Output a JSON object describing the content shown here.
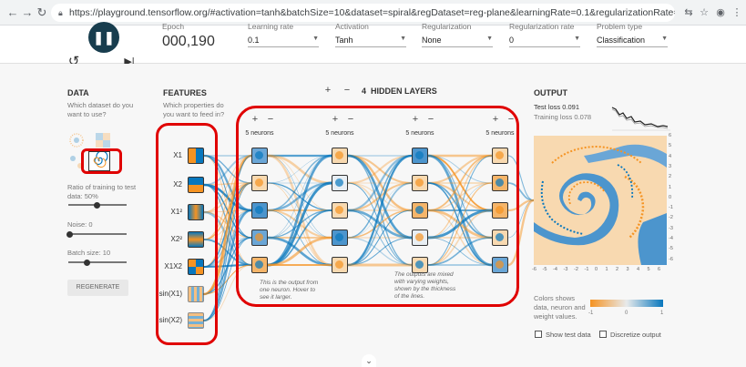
{
  "browser": {
    "url": "https://playground.tensorflow.org/#activation=tanh&batchSize=10&dataset=spiral&regDataset=reg-plane&learningRate=0.1&regularizationRate=0&noise=0&networkShape=5,5,5,5&s..."
  },
  "controls": {
    "epoch_label": "Epoch",
    "epoch_value": "000,190",
    "learning_rate_label": "Learning rate",
    "learning_rate_value": "0.1",
    "activation_label": "Activation",
    "activation_value": "Tanh",
    "regularization_label": "Regularization",
    "regularization_value": "None",
    "regularization_rate_label": "Regularization rate",
    "regularization_rate_value": "0",
    "problem_type_label": "Problem type",
    "problem_type_value": "Classification"
  },
  "data_panel": {
    "title": "DATA",
    "subtitle": "Which dataset do you want to use?",
    "ratio_label": "Ratio of training to test data:  50%",
    "noise_label": "Noise:  0",
    "batch_label": "Batch size:  10",
    "regenerate_label": "REGENERATE"
  },
  "features_panel": {
    "title": "FEATURES",
    "subtitle": "Which properties do you want to feed in?",
    "features": [
      "X1",
      "X2",
      "X1²",
      "X2²",
      "X1X2",
      "sin(X1)",
      "sin(X2)"
    ]
  },
  "network": {
    "hidden_layers_count": "4",
    "hidden_layers_label": "HIDDEN LAYERS",
    "layer_neuron_labels": [
      "5 neurons",
      "5 neurons",
      "5 neurons",
      "5 neurons"
    ],
    "annotation_1": "This is the output from one neuron. Hover to see it larger.",
    "annotation_2": "The outputs are mixed with varying weights, shown by the thickness of the lines."
  },
  "output_panel": {
    "title": "OUTPUT",
    "test_loss": "Test loss 0.091",
    "training_loss": "Training loss 0.078",
    "colors_note": "Colors shows data, neuron and weight values.",
    "legend_min": "-1",
    "legend_mid": "0",
    "legend_max": "1",
    "show_test_data_label": "Show test data",
    "discretize_label": "Discretize output",
    "x_ticks": [
      "-6",
      "-5",
      "-4",
      "-3",
      "-2",
      "-1",
      "0",
      "1",
      "2",
      "3",
      "4",
      "5",
      "6"
    ],
    "y_ticks": [
      "6",
      "5",
      "4",
      "3",
      "2",
      "1",
      "0",
      "-1",
      "-2",
      "-3",
      "-4",
      "-5",
      "-6"
    ]
  },
  "colors": {
    "orange": "#f59322",
    "blue": "#0877bd",
    "highlight": "#e00000",
    "play": "#183d4e"
  }
}
